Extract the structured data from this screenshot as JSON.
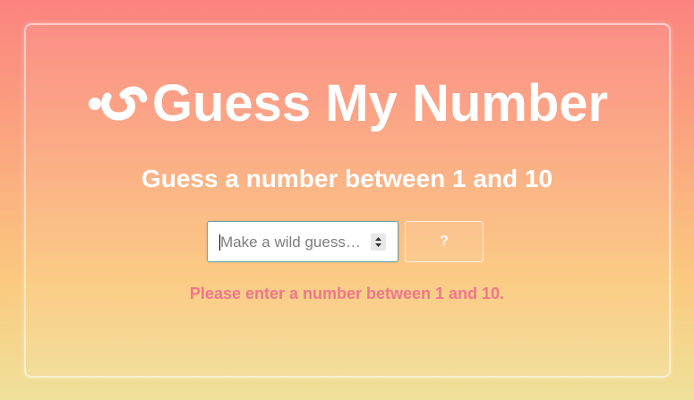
{
  "app": {
    "title": "Guess My Number",
    "logo_icon": "pinwheel-logo-icon"
  },
  "game": {
    "prompt": "Guess a number between 1 and 10",
    "range": {
      "min": 1,
      "max": 10
    }
  },
  "guess_input": {
    "value": "",
    "placeholder": "Make a wild guess…"
  },
  "submit_button": {
    "label": "?"
  },
  "message": {
    "text": "Please enter a number between 1 and 10."
  },
  "colors": {
    "background_top": "#fb837f",
    "background_bottom": "#efe19a",
    "title": "#ffffff",
    "message": "#f0768a",
    "input_border": "#5aa9ad"
  }
}
